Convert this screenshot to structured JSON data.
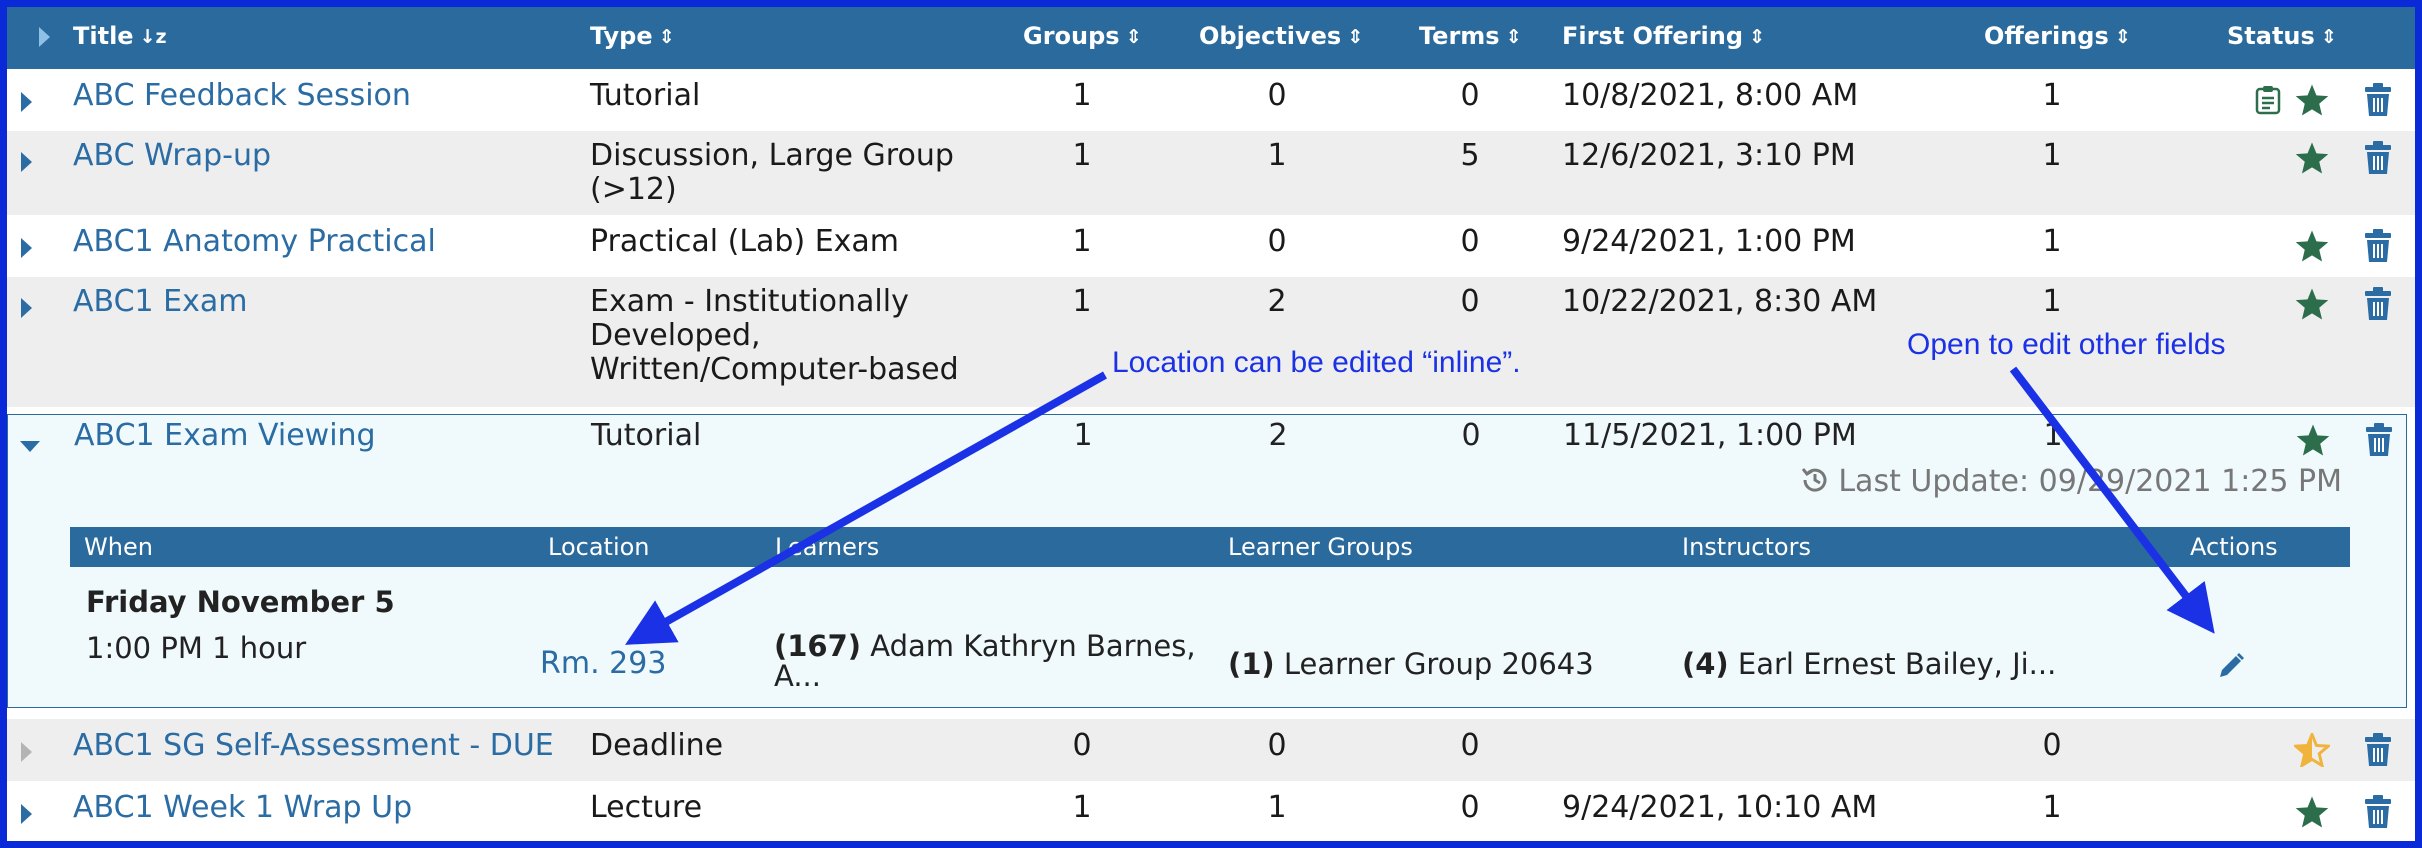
{
  "colors": {
    "border": "#0a2ad8",
    "header": "#2b6a9c",
    "link": "#2a6ca3",
    "star": "#2c6e4c",
    "star_inactive": "#f0b43c",
    "trash": "#2a6ca3",
    "annotation": "#1b31e6"
  },
  "columns": {
    "title": "Title",
    "type": "Type",
    "groups": "Groups",
    "objectives": "Objectives",
    "terms": "Terms",
    "first_offering": "First Offering",
    "offerings": "Offerings",
    "status": "Status"
  },
  "sort_icons": {
    "title": "↓z",
    "other": "⇕"
  },
  "rows": [
    {
      "title": "ABC Feedback Session",
      "type": "Tutorial",
      "groups": "1",
      "objectives": "0",
      "terms": "0",
      "first_offering": "10/8/2021, 8:00 AM",
      "offerings": "1",
      "status_icons": [
        "clipboard-icon",
        "star-icon"
      ]
    },
    {
      "title": "ABC Wrap-up",
      "type": "Discussion, Large Group (>12)",
      "groups": "1",
      "objectives": "1",
      "terms": "5",
      "first_offering": "12/6/2021, 3:10 PM",
      "offerings": "1",
      "status_icons": [
        "star-icon"
      ]
    },
    {
      "title": "ABC1 Anatomy Practical",
      "type": "Practical (Lab) Exam",
      "groups": "1",
      "objectives": "0",
      "terms": "0",
      "first_offering": "9/24/2021, 1:00 PM",
      "offerings": "1",
      "status_icons": [
        "star-icon"
      ]
    },
    {
      "title": "ABC1 Exam",
      "type": "Exam - Institutionally Developed, Written/Computer-based",
      "groups": "1",
      "objectives": "2",
      "terms": "0",
      "first_offering": "10/22/2021, 8:30 AM",
      "offerings": "1",
      "status_icons": [
        "star-icon"
      ]
    },
    {
      "title": "ABC1 Exam Viewing",
      "type": "Tutorial",
      "groups": "1",
      "objectives": "2",
      "terms": "0",
      "first_offering": "11/5/2021, 1:00 PM",
      "offerings": "1",
      "status_icons": [
        "star-icon"
      ]
    },
    {
      "title": "ABC1 SG Self-Assessment - DUE",
      "type": "Deadline",
      "groups": "0",
      "objectives": "0",
      "terms": "0",
      "first_offering": "",
      "offerings": "0",
      "status_icons": [
        "star-outline-icon"
      ]
    },
    {
      "title": "ABC1 Week 1 Wrap Up",
      "type": "Lecture",
      "groups": "1",
      "objectives": "1",
      "terms": "0",
      "first_offering": "9/24/2021, 10:10 AM",
      "offerings": "1",
      "status_icons": [
        "star-icon"
      ]
    }
  ],
  "expanded": {
    "last_update": "Last Update: 09/29/2021 1:25 PM",
    "columns": {
      "when": "When",
      "location": "Location",
      "learners": "Learners",
      "learner_groups": "Learner Groups",
      "instructors": "Instructors",
      "actions": "Actions"
    },
    "offering": {
      "date": "Friday November 5",
      "time": "1:00 PM 1 hour",
      "location": "Rm. 293",
      "learners_count": "(167)",
      "learners_names": "Adam Kathryn Barnes, A...",
      "groups_count": "(1)",
      "groups_names": "Learner Group 20643",
      "instructors_count": "(4)",
      "instructors_names": "Earl Ernest Bailey, Ji..."
    }
  },
  "annotations": {
    "inline": "Location can be edited “inline”.",
    "open": "Open to edit other fields"
  }
}
